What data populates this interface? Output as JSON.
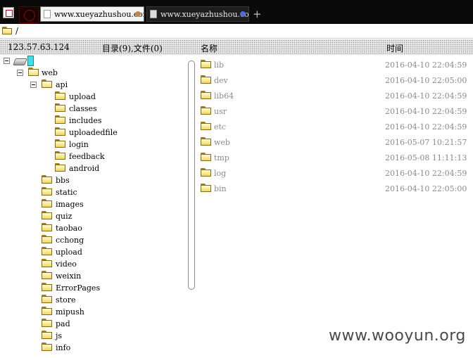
{
  "tabs": [
    {
      "label": "www.xueyazhushou.com",
      "active": true
    },
    {
      "label": "www.xueyazhushou.com",
      "active": false
    }
  ],
  "path": "/",
  "header": {
    "ip": "123.57.63.124",
    "counts": "目录(9),文件(0)",
    "name_col": "名称",
    "time_col": "时间"
  },
  "tree": {
    "root": {
      "label": "web",
      "expanded": true
    },
    "api": {
      "label": "api",
      "expanded": true
    },
    "api_children": [
      "upload",
      "classes",
      "includes",
      "uploadedfile",
      "login",
      "feedback",
      "android"
    ],
    "web_children": [
      "bbs",
      "static",
      "images",
      "quiz",
      "taobao",
      "cchong",
      "upload",
      "video",
      "weixin",
      "ErrorPages",
      "store",
      "mipush",
      "pad",
      "js",
      "info"
    ]
  },
  "files": [
    {
      "name": "lib",
      "time": "2016-04-10 22:04:59"
    },
    {
      "name": "dev",
      "time": "2016-04-10 22:05:00"
    },
    {
      "name": "lib64",
      "time": "2016-04-10 22:04:59"
    },
    {
      "name": "usr",
      "time": "2016-04-10 22:04:59"
    },
    {
      "name": "etc",
      "time": "2016-04-10 22:04:59"
    },
    {
      "name": "web",
      "time": "2016-05-07 10:21:57"
    },
    {
      "name": "tmp",
      "time": "2016-05-08 11:11:13"
    },
    {
      "name": "log",
      "time": "2016-04-10 22:04:59"
    },
    {
      "name": "bin",
      "time": "2016-04-10 22:05:00"
    }
  ],
  "watermark": "www.wooyun.org",
  "icons": {
    "folder": "folder-icon",
    "drive": "drive-icon",
    "page": "page-icon",
    "app": "app-icon"
  },
  "colors": {
    "tab_bar": "#0a0a0a",
    "selection": "#3ee0e8",
    "folder": "#f0d860"
  }
}
